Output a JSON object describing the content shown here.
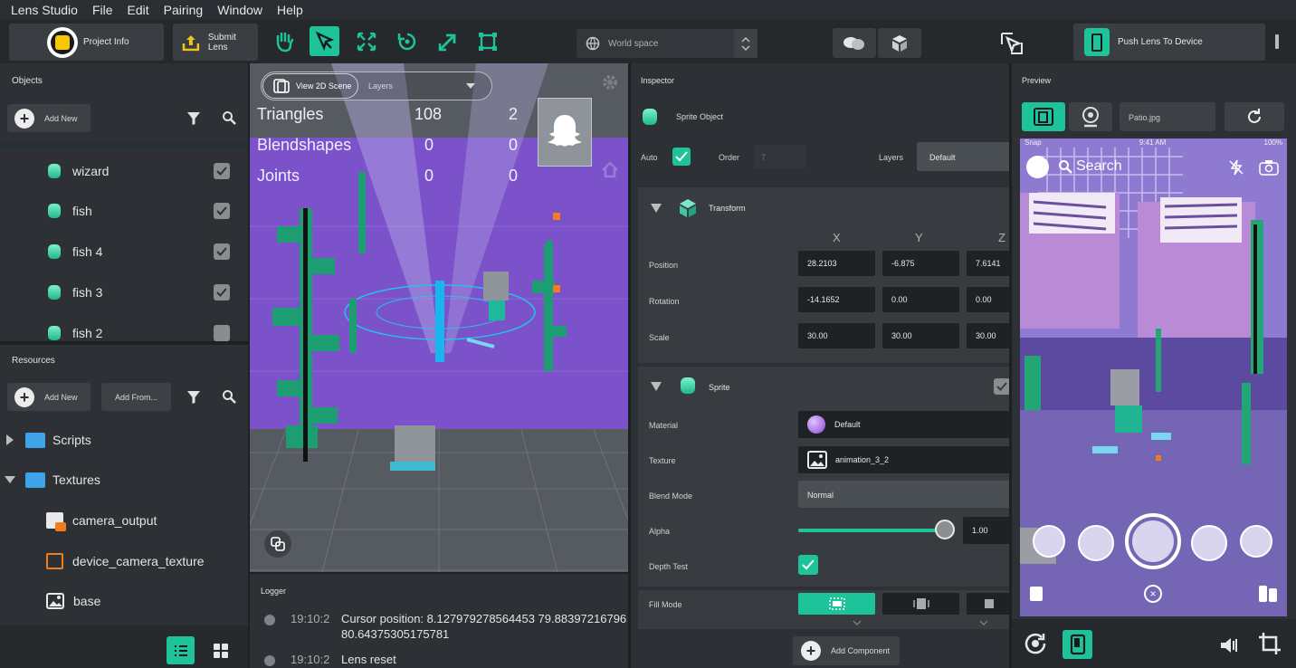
{
  "menu": [
    "Lens Studio",
    "File",
    "Edit",
    "Pairing",
    "Window",
    "Help"
  ],
  "toolbar": {
    "project_info": "Project Info",
    "submit_lens": "Submit Lens",
    "space_select": "World space",
    "push_lens": "Push Lens To Device"
  },
  "objects": {
    "title": "Objects",
    "add_new": "Add New",
    "items": [
      "wizard",
      "fish",
      "fish 4",
      "fish 3",
      "fish 2"
    ]
  },
  "resources": {
    "title": "Resources",
    "add_new": "Add New",
    "add_from": "Add From...",
    "items": [
      "Scripts",
      "Textures",
      "camera_output",
      "device_camera_texture",
      "base"
    ]
  },
  "scene": {
    "view2d": "View 2D Scene",
    "layers_placeholder": "Layers",
    "stats": [
      {
        "label": "Triangles",
        "a": "108",
        "b": "2"
      },
      {
        "label": "Blendshapes",
        "a": "0",
        "b": "0"
      },
      {
        "label": "Joints",
        "a": "0",
        "b": "0"
      }
    ]
  },
  "logger": {
    "title": "Logger",
    "entries": [
      {
        "time": "19:10:2",
        "msg": "Cursor position: 8.127979278564453 79.88397216796",
        "msg2": "80.64375305175781"
      },
      {
        "time": "19:10:2",
        "msg": "Lens reset",
        "msg2": ""
      }
    ]
  },
  "inspector": {
    "title": "Inspector",
    "object_name": "Sprite Object",
    "auto": "Auto",
    "order_label": "Order",
    "order_value": "7",
    "layers_label": "Layers",
    "layers_value": "Default",
    "transform": {
      "title": "Transform",
      "axes": [
        "X",
        "Y",
        "Z"
      ],
      "position_label": "Position",
      "position": [
        "28.2103",
        "-6.875",
        "7.6141"
      ],
      "rotation_label": "Rotation",
      "rotation": [
        "-14.1652",
        "0.00",
        "0.00"
      ],
      "scale_label": "Scale",
      "scale": [
        "30.00",
        "30.00",
        "30.00"
      ]
    },
    "sprite": {
      "title": "Sprite",
      "material_label": "Material",
      "material": "Default",
      "texture_label": "Texture",
      "texture": "animation_3_2",
      "blend_label": "Blend Mode",
      "blend": "Normal",
      "alpha_label": "Alpha",
      "alpha": "1.00",
      "alpha_fraction": 1.0,
      "depth_label": "Depth Test",
      "fill_label": "Fill Mode"
    },
    "add_component": "Add Component"
  },
  "preview": {
    "title": "Preview",
    "image_select": "Patio.jpg",
    "search": "Search",
    "carrier": "Snap",
    "time": "9:41 AM",
    "battery": "100%"
  },
  "colors": {
    "accent": "#1fc39a",
    "purple": "#7b52c9",
    "panel": "#2d3135"
  }
}
